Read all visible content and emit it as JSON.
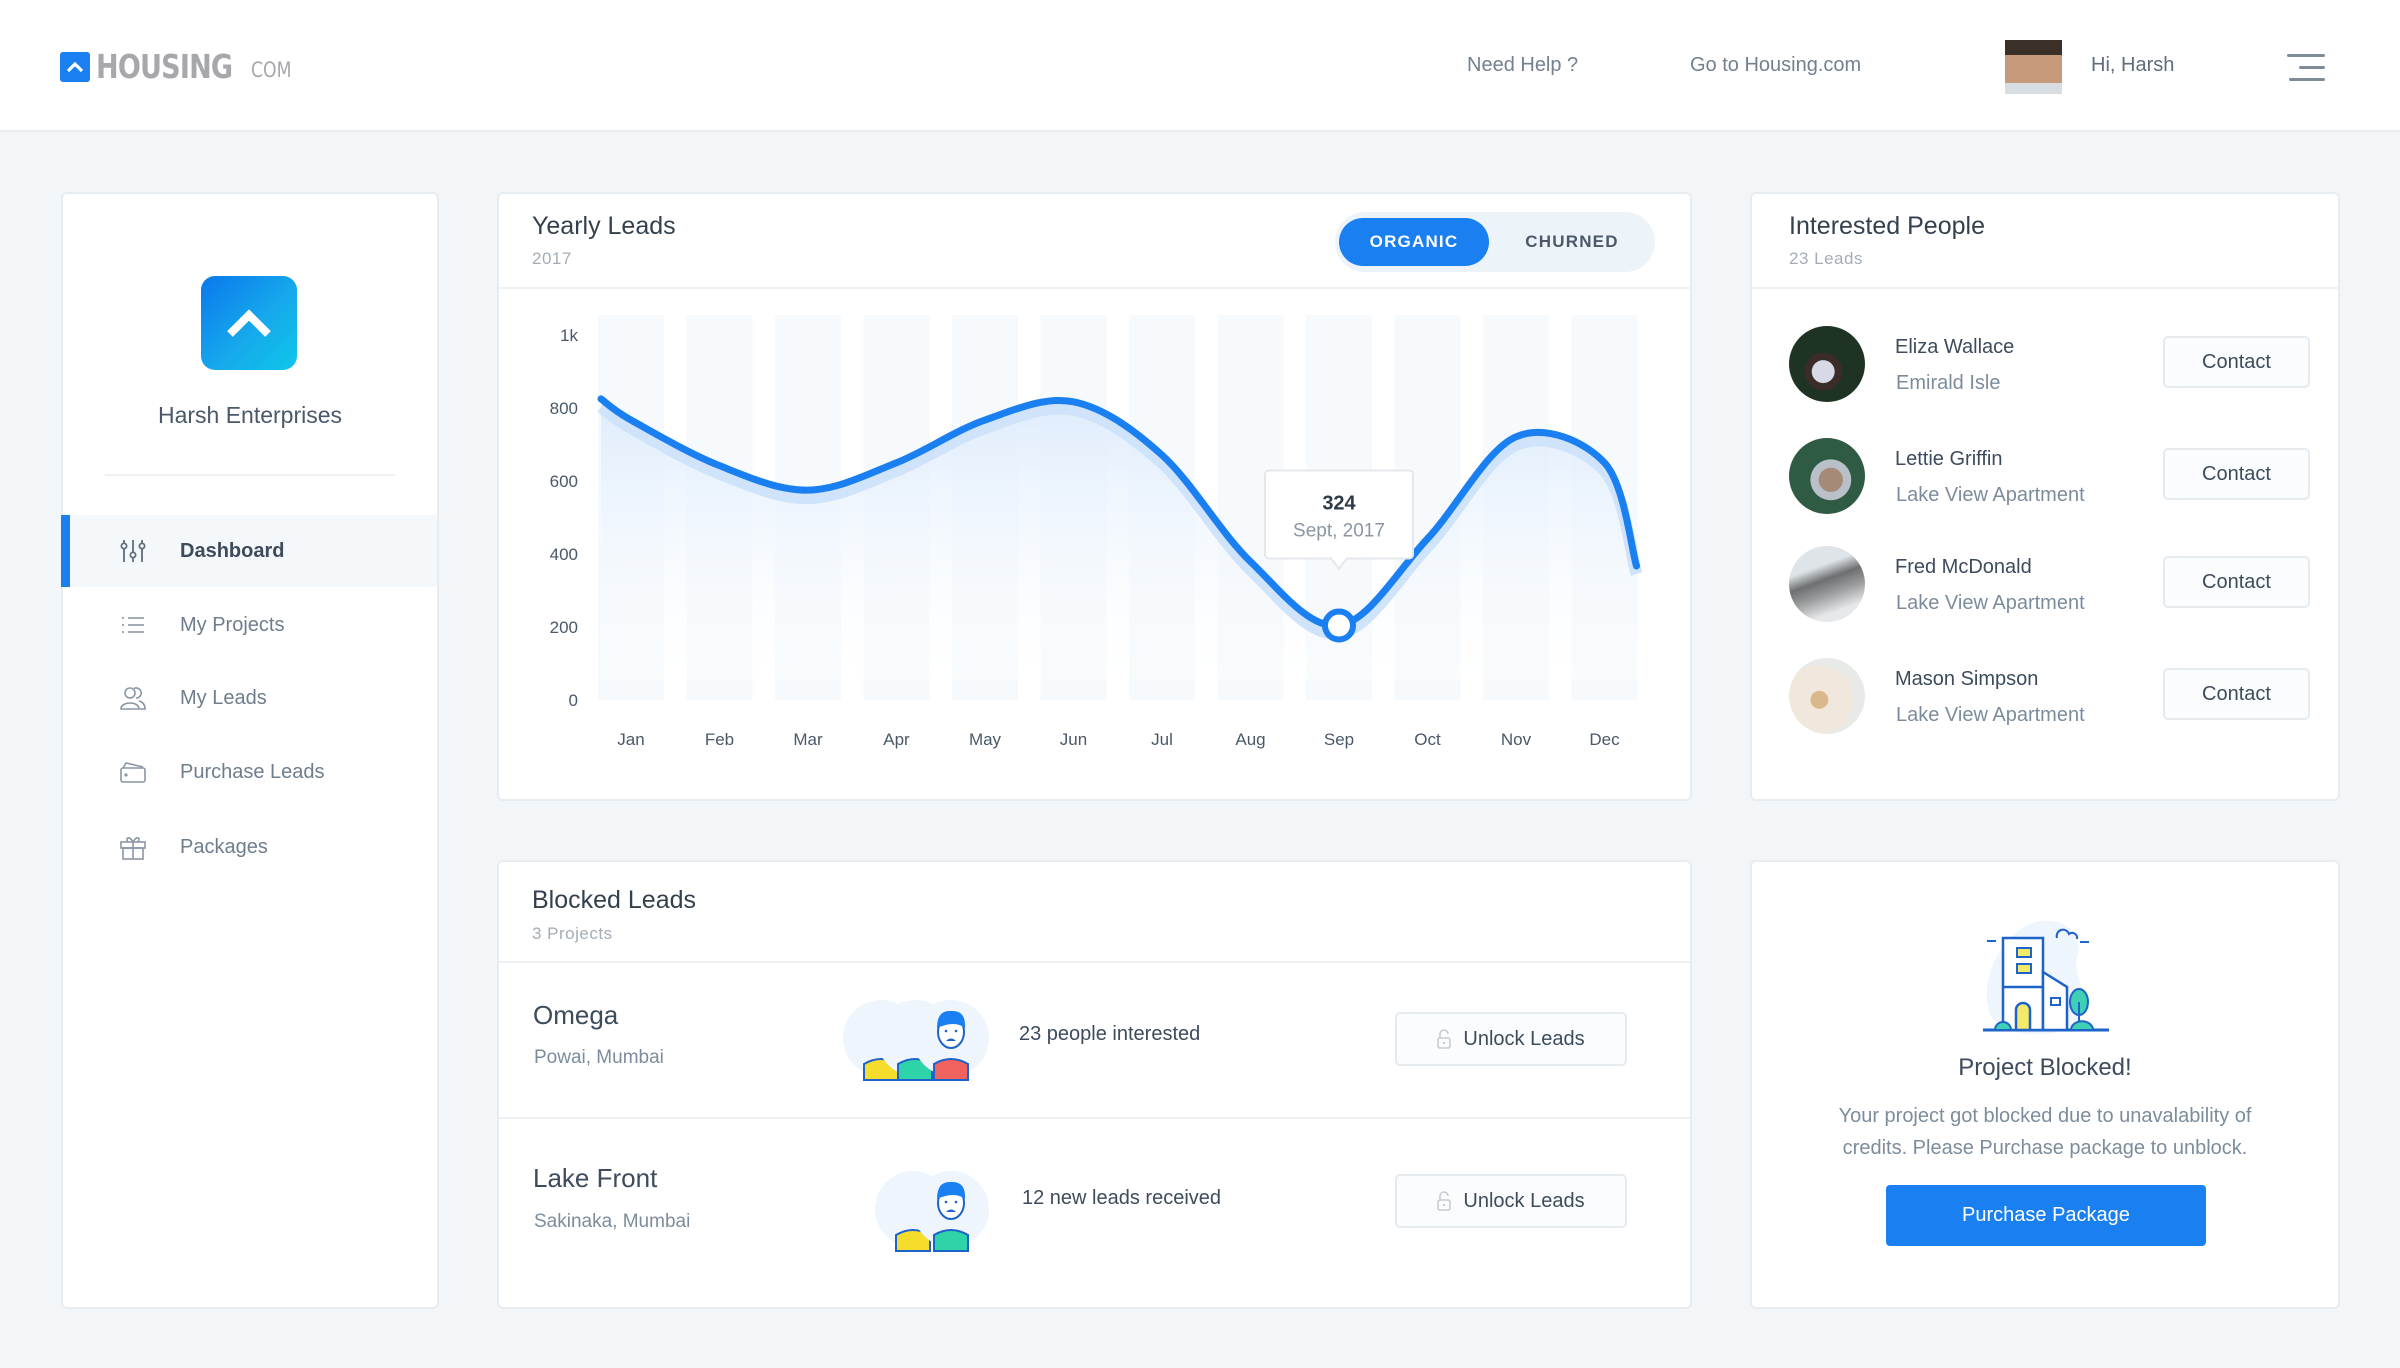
{
  "header": {
    "logo_text": "HOUSING",
    "logo_suffix": "COM",
    "nav": [
      "Need Help ?",
      "Go to Housing.com"
    ],
    "greeting": "Hi, Harsh"
  },
  "sidebar": {
    "company_name": "Harsh Enterprises",
    "items": [
      {
        "label": "Dashboard",
        "icon": "sliders-icon",
        "active": true
      },
      {
        "label": "My Projects",
        "icon": "list-icon",
        "active": false
      },
      {
        "label": "My Leads",
        "icon": "users-icon",
        "active": false
      },
      {
        "label": "Purchase Leads",
        "icon": "wallet-icon",
        "active": false
      },
      {
        "label": "Packages",
        "icon": "gift-icon",
        "active": false
      }
    ]
  },
  "yearly_leads": {
    "title": "Yearly Leads",
    "subtitle": "2017",
    "toggle": {
      "active": "ORGANIC",
      "inactive": "CHURNED"
    },
    "tooltip": {
      "value": "324",
      "label": "Sept, 2017"
    }
  },
  "chart_data": {
    "type": "area",
    "title": "Yearly Leads",
    "subtitle": "2017",
    "xlabel": "",
    "ylabel": "",
    "categories": [
      "Jan",
      "Feb",
      "Mar",
      "Apr",
      "May",
      "Jun",
      "Jul",
      "Aug",
      "Sep",
      "Oct",
      "Nov",
      "Dec"
    ],
    "y_ticks": [
      "0",
      "200",
      "400",
      "600",
      "800",
      "1k"
    ],
    "ylim": [
      0,
      1000
    ],
    "grid": false,
    "legend": "none",
    "series": [
      {
        "name": "Organic",
        "values": [
          767,
          642,
          575,
          650,
          767,
          817,
          671,
          379,
          204,
          442,
          721,
          650
        ]
      }
    ],
    "line_start_value": 825,
    "line_end_value": 367,
    "highlight": {
      "category": "Sep",
      "tooltip_value": 324,
      "tooltip_label": "Sept, 2017"
    },
    "colors": {
      "line": "#1a7ff0",
      "fill": "#e3f0fd"
    }
  },
  "interested": {
    "title": "Interested People",
    "subtitle": "23 Leads",
    "people": [
      {
        "name": "Eliza Wallace",
        "location": "Emirald Isle",
        "action": "Contact"
      },
      {
        "name": "Lettie Griffin",
        "location": "Lake View Apartment",
        "action": "Contact"
      },
      {
        "name": "Fred McDonald",
        "location": "Lake View Apartment",
        "action": "Contact"
      },
      {
        "name": "Mason Simpson",
        "location": "Lake View Apartment",
        "action": "Contact"
      }
    ]
  },
  "blocked": {
    "title": "Blocked Leads",
    "subtitle": "3 Projects",
    "projects": [
      {
        "name": "Omega",
        "location": "Powai, Mumbai",
        "info": "23 people interested",
        "action": "Unlock Leads"
      },
      {
        "name": "Lake Front",
        "location": "Sakinaka, Mumbai",
        "info": "12 new leads received",
        "action": "Unlock Leads"
      }
    ]
  },
  "project_blocked": {
    "title": "Project Blocked!",
    "message": "Your project got blocked due to unavalability of credits. Please Purchase package to unblock.",
    "button": "Purchase Package"
  },
  "colors": {
    "accent": "#1a7ff0",
    "background": "#f2f6f9"
  }
}
